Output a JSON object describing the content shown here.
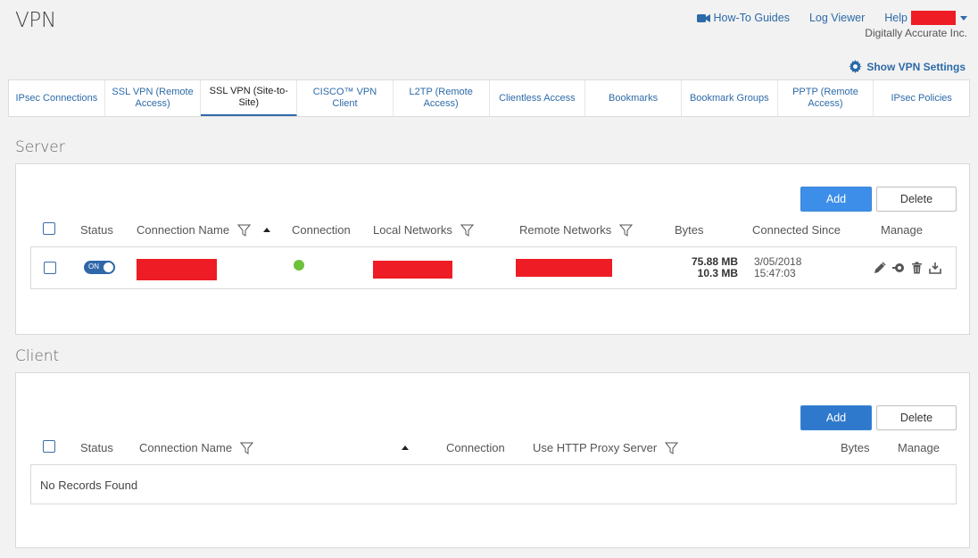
{
  "page": {
    "title": "VPN"
  },
  "top_nav": {
    "how_to": "How-To Guides",
    "log_viewer": "Log Viewer",
    "help": "Help",
    "company": "Digitally Accurate Inc."
  },
  "settings_link": "Show VPN Settings",
  "tabs": [
    {
      "label": "IPsec Connections"
    },
    {
      "label": "SSL VPN (Remote Access)"
    },
    {
      "label": "SSL VPN (Site-to-Site)",
      "active": true
    },
    {
      "label": "CISCO™ VPN Client"
    },
    {
      "label": "L2TP (Remote Access)"
    },
    {
      "label": "Clientless Access"
    },
    {
      "label": "Bookmarks"
    },
    {
      "label": "Bookmark Groups"
    },
    {
      "label": "PPTP (Remote Access)"
    },
    {
      "label": "IPsec Policies"
    }
  ],
  "server": {
    "title": "Server",
    "add_label": "Add",
    "delete_label": "Delete",
    "columns": {
      "status": "Status",
      "connection_name": "Connection Name",
      "connection": "Connection",
      "local_networks": "Local Networks",
      "remote_networks": "Remote Networks",
      "bytes": "Bytes",
      "connected_since": "Connected Since",
      "manage": "Manage"
    },
    "row": {
      "toggle": "ON",
      "bytes_in": "75.88 MB",
      "bytes_out": "10.3 MB",
      "since_date": "3/05/2018",
      "since_time": "15:47:03"
    }
  },
  "client": {
    "title": "Client",
    "add_label": "Add",
    "delete_label": "Delete",
    "columns": {
      "status": "Status",
      "connection_name": "Connection Name",
      "connection": "Connection",
      "use_http_proxy": "Use HTTP Proxy Server",
      "bytes": "Bytes",
      "manage": "Manage"
    },
    "empty": "No Records Found"
  },
  "colors": {
    "accent": "#2d6aa8",
    "add_button": "#3d8ee8",
    "redaction": "#ee1c24",
    "connected_dot": "#6cc23a"
  },
  "icons": [
    "video-camera-icon",
    "gear-icon",
    "filter-icon",
    "sort-ascending-icon",
    "edit-icon",
    "connect-icon",
    "trash-icon",
    "download-icon"
  ]
}
